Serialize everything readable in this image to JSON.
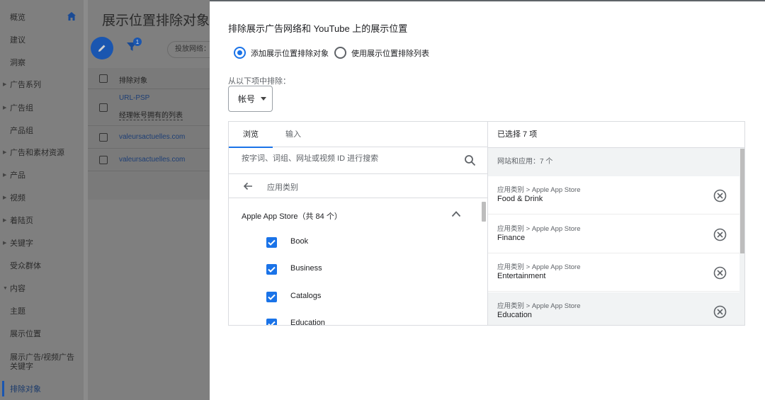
{
  "sidebar": {
    "items": [
      {
        "label": "概览",
        "arrow": false
      },
      {
        "label": "建议",
        "arrow": false
      },
      {
        "label": "洞察",
        "arrow": false
      },
      {
        "label": "广告系列",
        "arrow": true
      },
      {
        "label": "广告组",
        "arrow": true
      },
      {
        "label": "产品组",
        "arrow": false
      },
      {
        "label": "广告和素材资源",
        "arrow": true
      },
      {
        "label": "产品",
        "arrow": true
      },
      {
        "label": "视频",
        "arrow": true
      },
      {
        "label": "着陆页",
        "arrow": true
      },
      {
        "label": "关键字",
        "arrow": true
      },
      {
        "label": "受众群体",
        "arrow": false
      },
      {
        "label": "内容",
        "arrow": true
      },
      {
        "label": "主题",
        "arrow": false
      },
      {
        "label": "展示位置",
        "arrow": false
      },
      {
        "label": "展示广告/视频广告关键字",
        "arrow": false
      },
      {
        "label": "排除对象",
        "arrow": false
      }
    ]
  },
  "background": {
    "page_title": "展示位置排除对象",
    "filter_count": "1",
    "filter_chip": "投放网络：",
    "table_header": "排除对象",
    "rows": [
      {
        "line1": "URL-PSP",
        "line2": "经理帐号拥有的列表"
      },
      {
        "line1": "valeursactuelles.com"
      },
      {
        "line1": "valeursactuelles.com"
      }
    ]
  },
  "dialog": {
    "title": "排除展示广告网络和 YouTube 上的展示位置",
    "radio_add": "添加展示位置排除对象",
    "radio_list": "使用展示位置排除列表",
    "from_label": "从以下项中排除：",
    "account_select": "帐号",
    "tabs": [
      "浏览",
      "输入"
    ],
    "search_placeholder": "按字词、词组、网址或视频 ID 进行搜索",
    "breadcrumb": "应用类别",
    "group_title": "Apple App Store（共 84 个）",
    "checked_items": [
      "Book",
      "Business",
      "Catalogs",
      "Education"
    ],
    "selected_header": "已选择 7 项",
    "selected_sub": "网站和应用：7 个",
    "selected_items": [
      {
        "path": "应用类别 > Apple App Store",
        "name": "Food & Drink"
      },
      {
        "path": "应用类别 > Apple App Store",
        "name": "Finance"
      },
      {
        "path": "应用类别 > Apple App Store",
        "name": "Entertainment"
      },
      {
        "path": "应用类别 > Apple App Store",
        "name": "Education"
      }
    ]
  },
  "colors": {
    "accent": "#1a73e8",
    "overlay": "#7f7f7f",
    "sidebar_active": "#1a56b0"
  }
}
